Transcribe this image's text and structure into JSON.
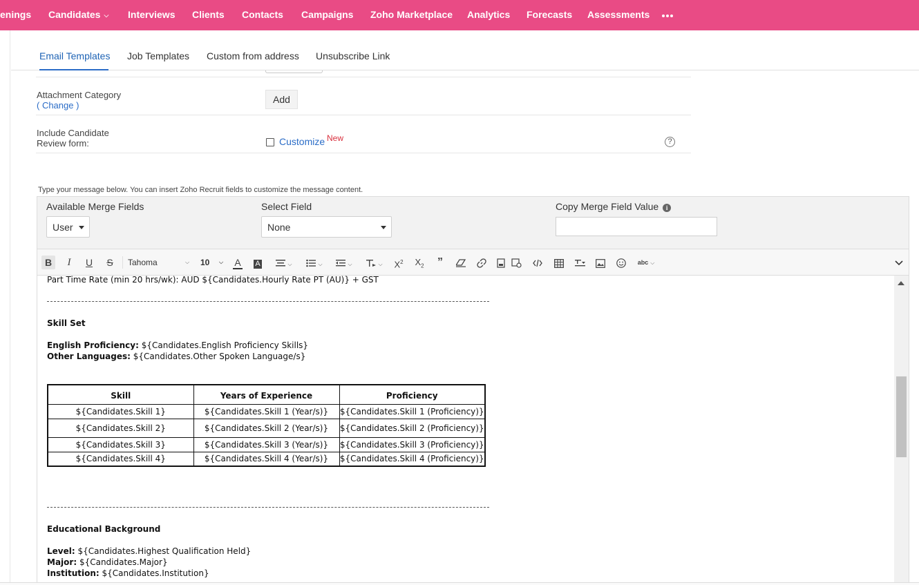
{
  "nav": {
    "items": [
      {
        "label": "enings",
        "has_chevron": false
      },
      {
        "label": "Candidates",
        "has_chevron": true
      },
      {
        "label": "Interviews",
        "has_chevron": false
      },
      {
        "label": "Clients",
        "has_chevron": false
      },
      {
        "label": "Contacts",
        "has_chevron": false
      },
      {
        "label": "Campaigns",
        "has_chevron": false
      },
      {
        "label": "Zoho Marketplace",
        "has_chevron": false
      },
      {
        "label": "Analytics",
        "has_chevron": false
      },
      {
        "label": "Forecasts",
        "has_chevron": false
      },
      {
        "label": "Assessments",
        "has_chevron": false
      }
    ],
    "more_icon": "more-horizontal-icon",
    "bg_color": "#e94b85"
  },
  "subtabs": {
    "items": [
      "Email Templates",
      "Job Templates",
      "Custom from address",
      "Unsubscribe Link"
    ],
    "active": "Email Templates"
  },
  "form": {
    "attachment_label": "Attachment Category",
    "attachment_change": "( Change )",
    "add_button": "Add",
    "review_label_line1": "Include Candidate",
    "review_label_line2": "Review form:",
    "customize_link": "Customize",
    "new_badge": "New",
    "help_icon": "?"
  },
  "hint": "Type your message below. You can insert Zoho Recruit fields to customize the message content.",
  "merge": {
    "available_label": "Available Merge Fields",
    "available_value": "User",
    "select_label": "Select Field",
    "select_value": "None",
    "copy_label": "Copy Merge Field Value",
    "copy_value": ""
  },
  "toolbar": {
    "font_family": "Tahoma",
    "font_size": "10",
    "icons": [
      "bold-icon",
      "italic-icon",
      "underline-icon",
      "strikethrough-icon",
      "font-color-icon",
      "background-color-icon",
      "align-icon",
      "list-icon",
      "indent-icon",
      "line-height-icon",
      "superscript-icon",
      "subscript-icon",
      "blockquote-icon",
      "clear-format-icon",
      "link-icon",
      "template-icon",
      "merge-field-icon",
      "code-icon",
      "table-icon",
      "format-painter-icon",
      "image-icon",
      "emoji-icon",
      "spellcheck-icon",
      "expand-chevron-icon"
    ]
  },
  "editor": {
    "line_pt_rate": "Part Time Rate (min 20 hrs/wk): AUD ${Candidates.Hourly Rate PT (AU)} + GST",
    "skill_set_heading": "Skill Set",
    "english_label": "English Proficiency:",
    "english_value": " ${Candidates.English Proficiency Skills}",
    "other_lang_label": "Other Languages:",
    "other_lang_value": " ${Candidates.Other Spoken Language/s}",
    "table": {
      "headers": [
        "Skill",
        "Years of Experience",
        "Proficiency"
      ],
      "rows": [
        [
          "${Candidates.Skill 1}",
          "${Candidates.Skill 1 (Year/s)}",
          "${Candidates.Skill 1 (Proficiency)}"
        ],
        [
          "${Candidates.Skill 2}",
          "${Candidates.Skill 2 (Year/s)}",
          "${Candidates.Skill 2 (Proficiency)}"
        ],
        [
          "${Candidates.Skill 3}",
          "${Candidates.Skill 3 (Year/s)}",
          "${Candidates.Skill 3 (Proficiency)}"
        ],
        [
          "${Candidates.Skill 4}",
          "${Candidates.Skill 4 (Year/s)}",
          "${Candidates.Skill 4 (Proficiency)}"
        ]
      ]
    },
    "edu_heading": "Educational Background",
    "level_label": "Level:",
    "level_value": " ${Candidates.Highest Qualification Held}",
    "major_label": "Major:",
    "major_value": " ${Candidates.Major}",
    "institution_label": "Institution:",
    "institution_value": " ${Candidates.Institution}"
  }
}
